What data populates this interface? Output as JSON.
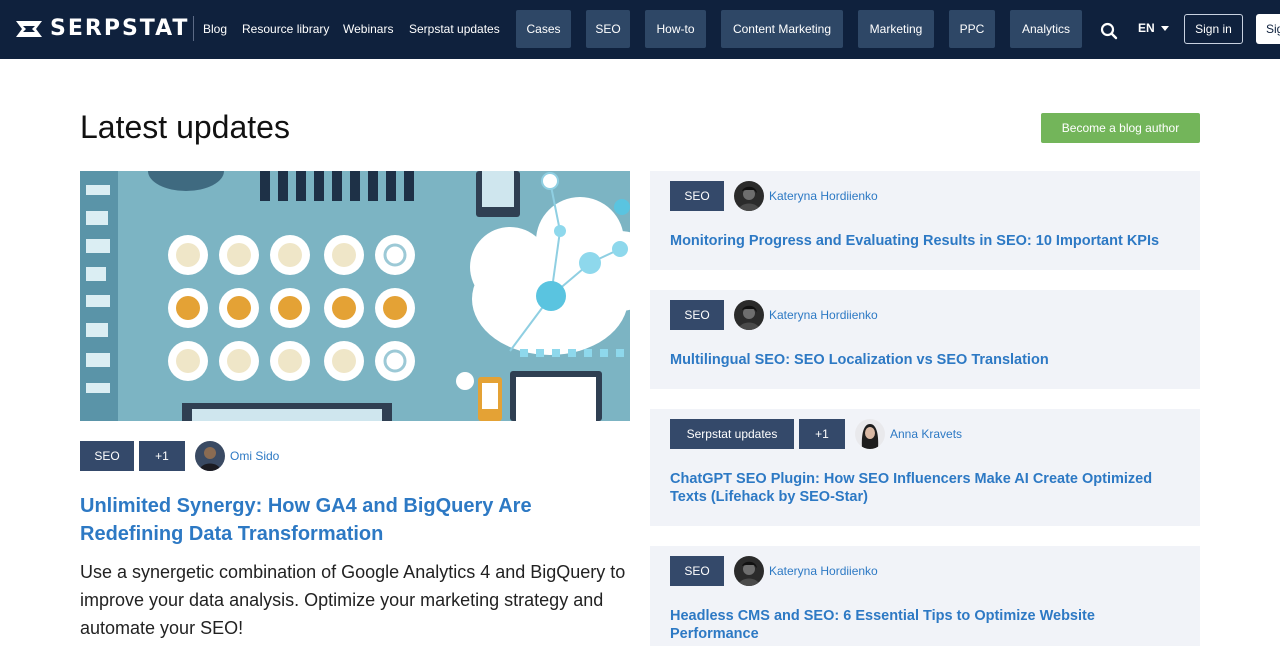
{
  "header": {
    "logo_text": "SERPSTAT",
    "links": [
      "Blog",
      "Resource library",
      "Webinars",
      "Serpstat updates"
    ],
    "categories": [
      "Cases",
      "SEO",
      "How-to",
      "Content Marketing",
      "Marketing",
      "PPC",
      "Analytics"
    ],
    "language": "EN",
    "sign_in": "Sign in",
    "sign_up": "Sig"
  },
  "page": {
    "title": "Latest updates",
    "become_author": "Become a blog author"
  },
  "featured": {
    "tags": [
      "SEO",
      "+1"
    ],
    "author": "Omi Sido",
    "title": "Unlimited Synergy: How GA4 and BigQuery Are Redefining Data Transformation",
    "description": "Use a synergetic combination of Google Analytics 4 and BigQuery to improve your data analysis. Optimize your marketing strategy and automate your SEO!"
  },
  "articles": [
    {
      "tags": [
        "SEO"
      ],
      "author": "Kateryna Hordiienko",
      "title": "Monitoring Progress and Evaluating Results in SEO: 10 Important KPIs"
    },
    {
      "tags": [
        "SEO"
      ],
      "author": "Kateryna Hordiienko",
      "title": "Multilingual SEO: SEO Localization vs SEO Translation"
    },
    {
      "tags": [
        "Serpstat updates",
        "+1"
      ],
      "author": "Anna Kravets",
      "title": "ChatGPT SEO Plugin: How SEO Influencers Make AI Create Optimized Texts (Lifehack by SEO-Star)"
    },
    {
      "tags": [
        "SEO"
      ],
      "author": "Kateryna Hordiienko",
      "title": "Headless CMS and SEO: 6 Essential Tips to Optimize Website Performance"
    }
  ],
  "icons": {
    "logo": "serpstat-logo-icon",
    "search": "search-icon",
    "language_caret": "chevron-down-icon"
  },
  "colors": {
    "header_bg": "#0f213d",
    "nav_button_bg": "#2e4766",
    "accent_link": "#2d79c4",
    "author_button": "#73b55a",
    "tag_bg": "#34496a",
    "card_bg": "#f1f3f8"
  }
}
